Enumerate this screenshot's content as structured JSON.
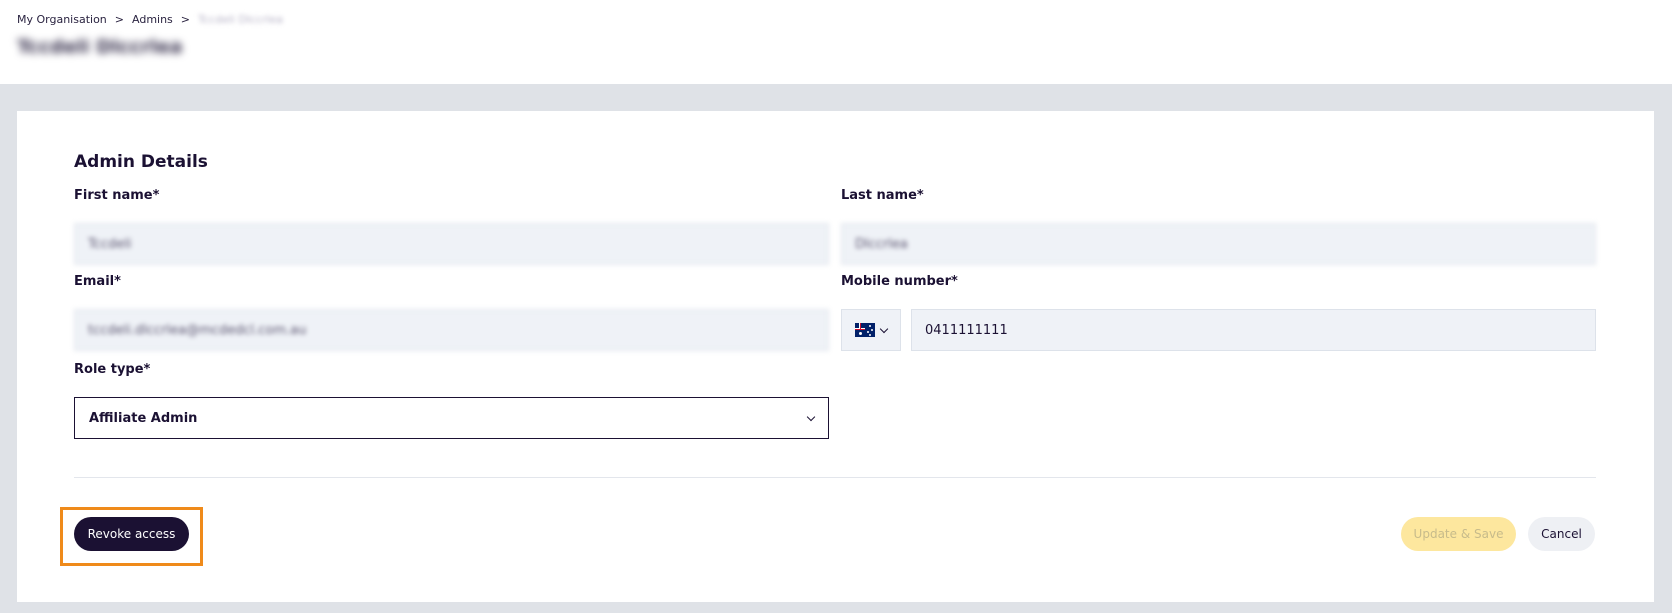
{
  "breadcrumb": {
    "items": [
      "My Organisation",
      "Admins"
    ],
    "separator": ">",
    "current": "Tccdeli Dlccrlea"
  },
  "page": {
    "title": "Tccdeli Dlccrlea"
  },
  "form": {
    "section_title": "Admin Details",
    "first_name": {
      "label": "First name*",
      "value": "Tccdeli"
    },
    "last_name": {
      "label": "Last name*",
      "value": "Dlccrlea"
    },
    "email": {
      "label": "Email*",
      "value": "tccdeli.dlccrlea@mcdedcl.com.au"
    },
    "mobile": {
      "label": "Mobile number*",
      "country_icon": "australia-flag-icon",
      "value": "0411111111"
    },
    "role_type": {
      "label": "Role type*",
      "value": "Affiliate Admin"
    }
  },
  "actions": {
    "revoke_label": "Revoke access",
    "save_label": "Update & Save",
    "cancel_label": "Cancel"
  },
  "colors": {
    "primary": "#1b1133",
    "highlight": "#ef8a1a",
    "save_disabled": "#fde79e",
    "input_bg": "#eff2f7",
    "page_bg": "#dfe2e7"
  }
}
